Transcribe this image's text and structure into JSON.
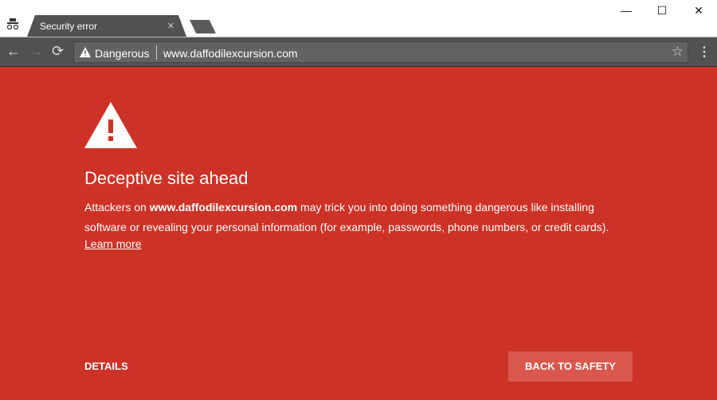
{
  "tab": {
    "title": "Security error",
    "close": "×"
  },
  "window": {
    "minimize": "—",
    "maximize": "☐",
    "close": "✕"
  },
  "toolbar": {
    "back": "←",
    "forward": "→",
    "reload": "⟳",
    "security_label": "Dangerous",
    "url": "www.daffodilexcursion.com",
    "star": "☆",
    "menu": "⋮"
  },
  "page": {
    "title": "Deceptive site ahead",
    "msg_prefix": "Attackers on ",
    "msg_domain": "www.daffodilexcursion.com",
    "msg_suffix": " may trick you into doing something dangerous like installing software or revealing your personal information (for example, passwords, phone numbers, or credit cards).",
    "learn_more": "Learn more",
    "details": "DETAILS",
    "back_to_safety": "BACK TO SAFETY"
  },
  "colors": {
    "background": "#cd3226",
    "button": "#d9574c"
  }
}
